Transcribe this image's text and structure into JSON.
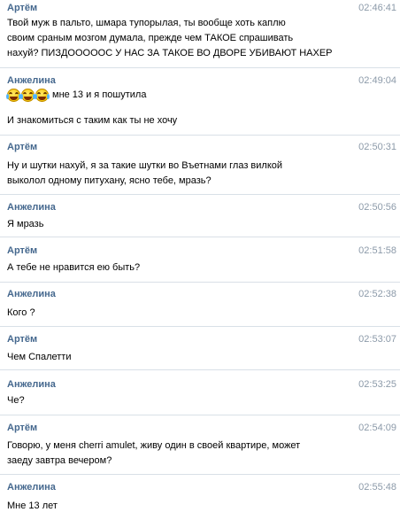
{
  "messages": [
    {
      "author": "Артём",
      "time": "02:46:41",
      "lines": [
        "Твой муж в пальто, шмара тупорылая, ты вообще хоть каплю",
        "своим сраным мозгом думала, прежде чем ТАКОЕ спрашивать",
        "нахуй? ПИЗДОООООС У НАС ЗА ТАКОЕ ВО ДВОРЕ УБИВАЮТ НАХЕР"
      ]
    },
    {
      "author": "Анжелина",
      "time": "02:49:04",
      "emoji": "rolling-laughing-icon",
      "emoji_count": 3,
      "emoji_text": "мне 13 и я пошутила",
      "lines": [
        "И знакомиться с таким как ты не хочу"
      ]
    },
    {
      "author": "Артём",
      "time": "02:50:31",
      "lines": [
        "Ну и шутки нахуй, я за такие шутки во Въетнами глаз вилкой",
        "выколол одному питухану, ясно тебе, мразь?"
      ]
    },
    {
      "author": "Анжелина",
      "time": "02:50:56",
      "lines": [
        "Я мразь"
      ]
    },
    {
      "author": "Артём",
      "time": "02:51:58",
      "lines": [
        "А тебе не нравится ею быть?"
      ]
    },
    {
      "author": "Анжелина",
      "time": "02:52:38",
      "lines": [
        "Кого ?"
      ]
    },
    {
      "author": "Артём",
      "time": "02:53:07",
      "lines": [
        "Чем Спалетти"
      ]
    },
    {
      "author": "Анжелина",
      "time": "02:53:25",
      "lines": [
        "Че?"
      ]
    },
    {
      "author": "Артём",
      "time": "02:54:09",
      "lines": [
        "Говорю, у меня cherri amulet, живу один в своей квартире, может",
        "заеду завтра вечером?"
      ]
    },
    {
      "author": "Анжелина",
      "time": "02:55:48",
      "lines": [
        "Мне 13 лет"
      ]
    }
  ]
}
